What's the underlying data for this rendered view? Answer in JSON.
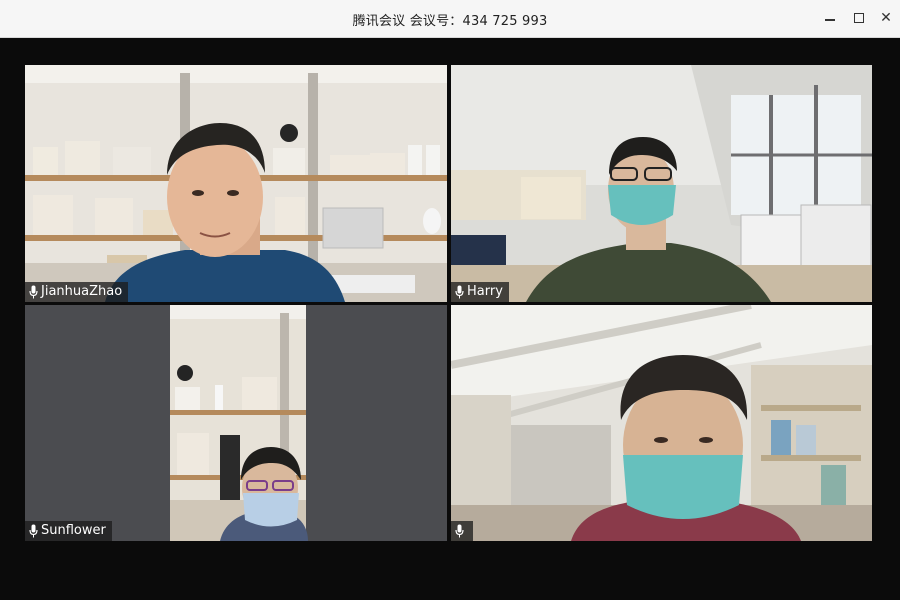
{
  "window": {
    "title": "腾讯会议 会议号：434 725 993",
    "controls": [
      "minimize",
      "maximize",
      "close"
    ],
    "minimize_glyph": "—",
    "close_glyph": "✕"
  },
  "participants": [
    {
      "name": "JianhuaZhao",
      "icon": "mic-icon"
    },
    {
      "name": "Harry",
      "icon": "mic-icon"
    },
    {
      "name": "Sunflower",
      "icon": "mic-icon"
    },
    {
      "name": "",
      "icon": "mic-icon"
    }
  ],
  "colors": {
    "titlebar": "#f6f6f6",
    "stage": "#0b0b0b",
    "empty_tile": "#4b4c50"
  }
}
